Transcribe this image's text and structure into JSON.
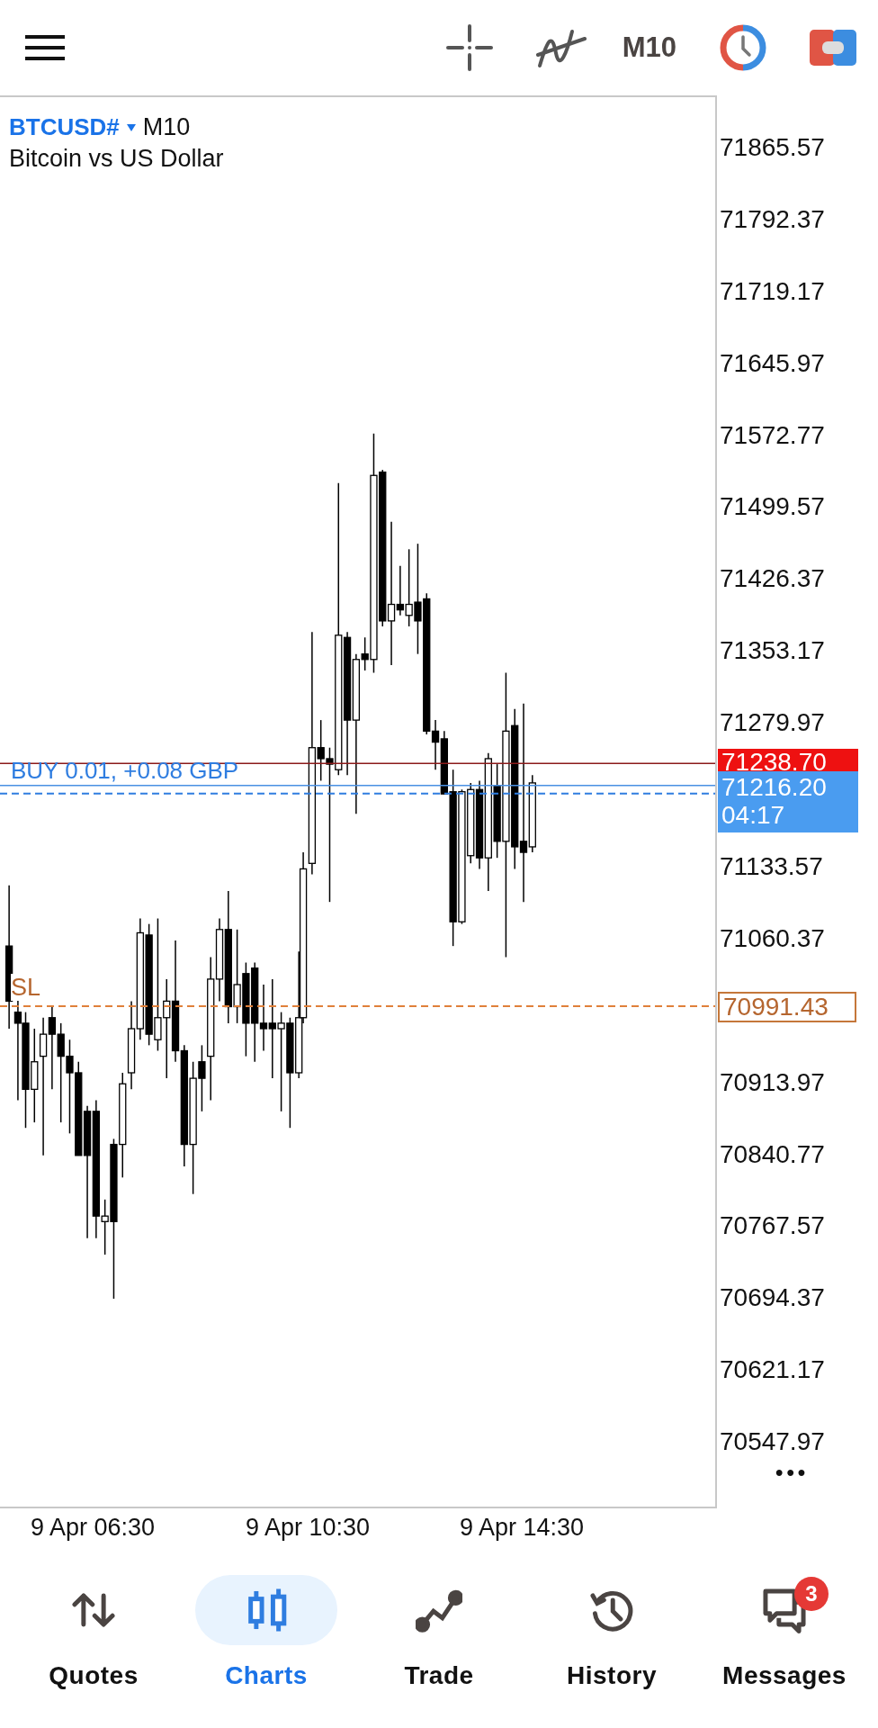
{
  "toolbar": {
    "timeframe": "M10"
  },
  "chart": {
    "symbol": "BTCUSD#",
    "period": "M10",
    "description": "Bitcoin vs US Dollar",
    "price_ticks": [
      "71865.57",
      "71792.37",
      "71719.17",
      "71645.97",
      "71572.77",
      "71499.57",
      "71426.37",
      "71353.17",
      "71279.97",
      "71133.57",
      "71060.37",
      "70913.97",
      "70840.77",
      "70767.57",
      "70694.37",
      "70621.17",
      "70547.97"
    ],
    "ask_price": "71238.70",
    "bid_price": "71216.20",
    "countdown": "04:17",
    "position_label": "BUY 0.01,  +0.08 GBP",
    "sl_label": "SL",
    "sl_price": "70991.43",
    "more": "•••",
    "time_labels": [
      "9 Apr 06:30",
      "9 Apr 10:30",
      "9 Apr 14:30"
    ]
  },
  "nav": [
    {
      "label": "Quotes",
      "kind": "quotes",
      "selected": false
    },
    {
      "label": "Charts",
      "kind": "charts",
      "selected": true
    },
    {
      "label": "Trade",
      "kind": "trade",
      "selected": false
    },
    {
      "label": "History",
      "kind": "history",
      "selected": false
    },
    {
      "label": "Messages",
      "kind": "messages",
      "selected": false,
      "badge": "3"
    }
  ]
}
